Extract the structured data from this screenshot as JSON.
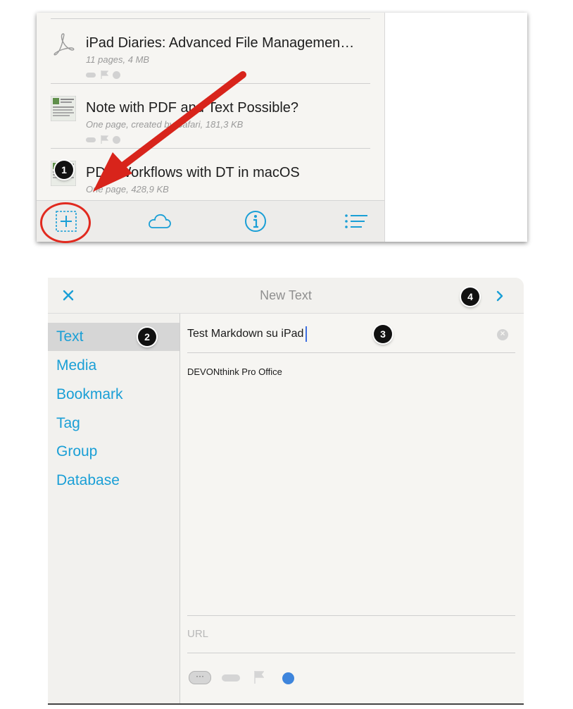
{
  "top_panel": {
    "documents": [
      {
        "title": "iPad Diaries: Advanced File Managemen…",
        "meta": "11 pages, 4 MB",
        "thumb": "pdf-icon",
        "dot_color": "#d2d2d2"
      },
      {
        "title": "Note with PDF and Text Possible?",
        "meta": "One page, created by Safari, 181,3 KB",
        "thumb": "document-thumbnail",
        "dot_color": "#d2d2d2"
      },
      {
        "title": "PDF Workflows with DT in macOS",
        "meta": "One page, 428,9 KB",
        "thumb": "document-thumbnail",
        "dot_color": "#3e85dc"
      }
    ],
    "toolbar": {
      "icons": [
        "add-icon",
        "cloud-icon",
        "info-icon",
        "list-icon"
      ]
    }
  },
  "modal": {
    "title": "New Text",
    "close_icon": "close-icon",
    "next_icon": "chevron-right-icon",
    "sidebar": {
      "items": [
        {
          "label": "Text",
          "selected": true
        },
        {
          "label": "Media",
          "selected": false
        },
        {
          "label": "Bookmark",
          "selected": false
        },
        {
          "label": "Tag",
          "selected": false
        },
        {
          "label": "Group",
          "selected": false
        },
        {
          "label": "Database",
          "selected": false
        }
      ]
    },
    "name_value": "Test Markdown su iPad",
    "body_text": "DEVONthink Pro Office",
    "url_placeholder": "URL",
    "more_label": "···",
    "label_color": "#3e85dc"
  },
  "callouts": [
    "1",
    "2",
    "3",
    "4"
  ],
  "colors": {
    "accent": "#1a9fd6",
    "annotation_red": "#e12a1f",
    "selected_bg": "#d6d6d6"
  }
}
